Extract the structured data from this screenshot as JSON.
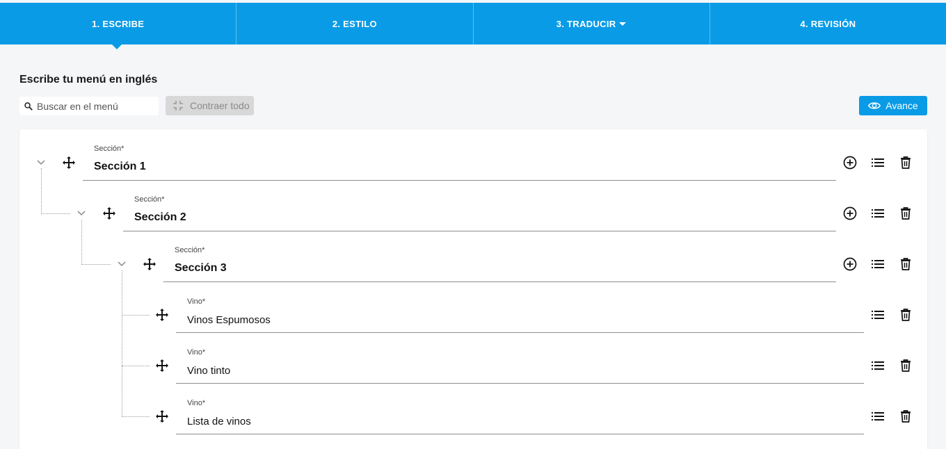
{
  "steps": [
    {
      "label": "1. ESCRIBE",
      "active": true
    },
    {
      "label": "2. ESTILO",
      "active": false
    },
    {
      "label": "3. TRADUCIR",
      "active": false,
      "has_dropdown": true
    },
    {
      "label": "4. REVISIÓN",
      "active": false
    }
  ],
  "page": {
    "title": "Escribe tu menú en inglés"
  },
  "toolbar": {
    "search_placeholder": "Buscar en el menú",
    "search_value": "",
    "collapse_label": "Contraer todo",
    "preview_label": "Avance"
  },
  "menu": {
    "sections": [
      {
        "label": "Sección*",
        "value": "Sección 1",
        "level": 0
      },
      {
        "label": "Sección*",
        "value": "Sección 2",
        "level": 1
      },
      {
        "label": "Sección*",
        "value": "Sección 3",
        "level": 2
      }
    ],
    "items": [
      {
        "label": "Vino*",
        "value": "Vinos Espumosos"
      },
      {
        "label": "Vino*",
        "value": "Vino tinto"
      },
      {
        "label": "Vino*",
        "value": "Lista de vinos"
      }
    ]
  },
  "colors": {
    "accent": "#0a9be6",
    "disabled_bg": "#d8d8d8",
    "background": "#f5f6f8"
  },
  "icons": [
    "search-icon",
    "collapse-icon",
    "eye-icon",
    "chevron-down-icon",
    "move-icon",
    "add-circle-icon",
    "list-icon",
    "trash-icon"
  ]
}
